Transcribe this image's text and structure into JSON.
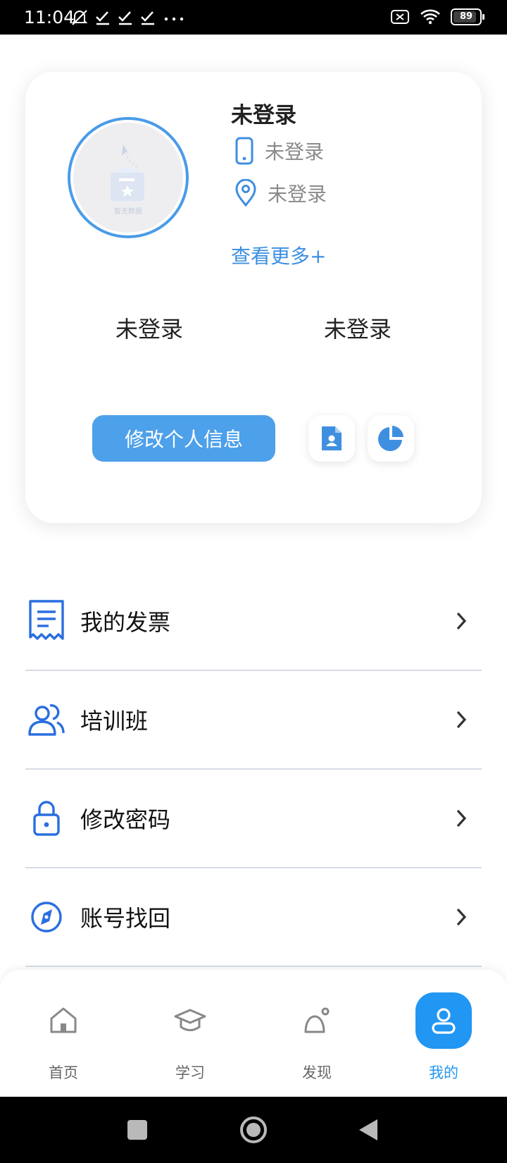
{
  "status_bar": {
    "time": "11:04",
    "battery": "89",
    "battery_level": 0.89
  },
  "profile": {
    "name": "未登录",
    "phone": "未登录",
    "location": "未登录",
    "more_link": "查看更多+",
    "stat_left": "未登录",
    "stat_right": "未登录",
    "edit_button": "修改个人信息",
    "avatar_placeholder": "暂无数据"
  },
  "menu": {
    "items": [
      {
        "label": "我的发票",
        "icon": "invoice-icon"
      },
      {
        "label": "培训班",
        "icon": "users-icon"
      },
      {
        "label": "修改密码",
        "icon": "lock-icon"
      },
      {
        "label": "账号找回",
        "icon": "compass-icon"
      }
    ]
  },
  "tabbar": {
    "tabs": [
      {
        "label": "首页",
        "icon": "home-icon"
      },
      {
        "label": "学习",
        "icon": "graduation-cap-icon"
      },
      {
        "label": "发现",
        "icon": "discover-icon"
      },
      {
        "label": "我的",
        "icon": "user-icon",
        "active": true
      }
    ]
  },
  "colors": {
    "accent": "#4da0ea",
    "active_tab": "#2196f3",
    "menu_icon": "#2a6ee0"
  }
}
